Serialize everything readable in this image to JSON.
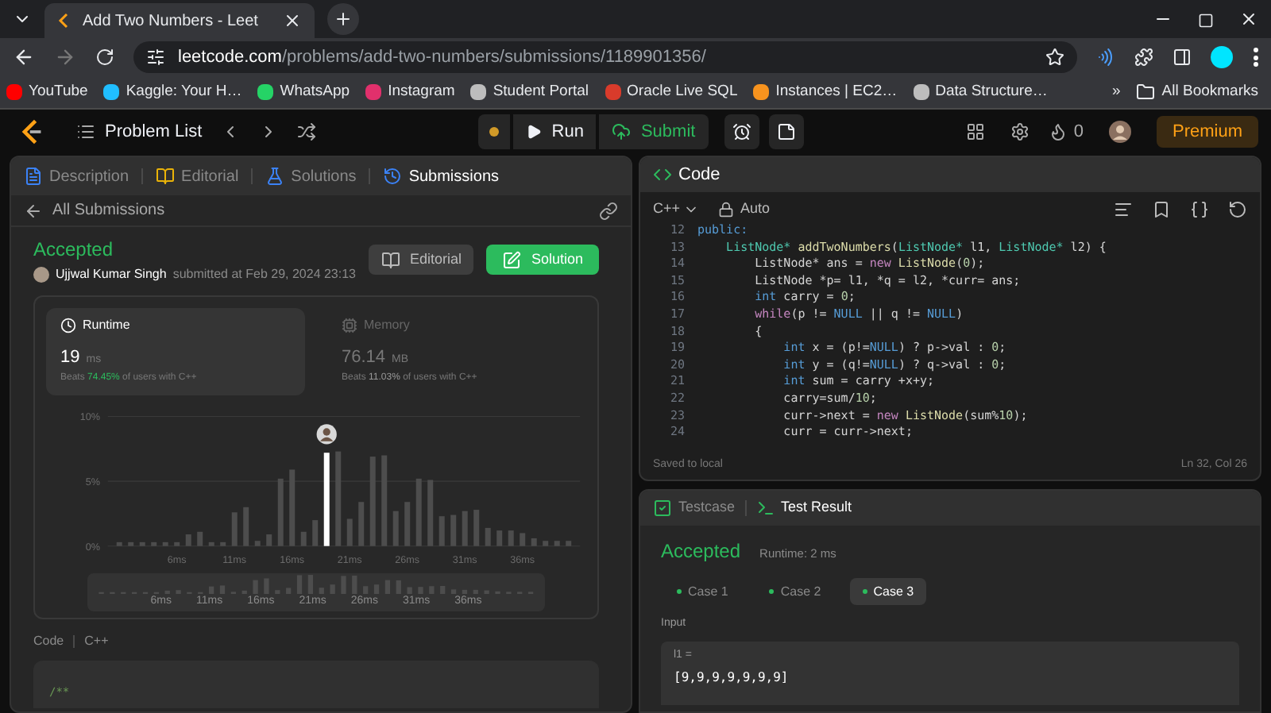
{
  "browser": {
    "tab_title": "Add Two Numbers - Leet",
    "url_domain": "leetcode.com",
    "url_path": "/problems/add-two-numbers/submissions/1189901356/",
    "bookmarks": [
      {
        "label": "YouTube",
        "color": "#ff0000"
      },
      {
        "label": "Kaggle: Your H…",
        "color": "#20beff"
      },
      {
        "label": "WhatsApp",
        "color": "#25d366"
      },
      {
        "label": "Instagram",
        "color": "#e1306c"
      },
      {
        "label": "Student Portal",
        "color": "#bdbdbd"
      },
      {
        "label": "Oracle Live SQL",
        "color": "#d93b2b"
      },
      {
        "label": "Instances | EC2…",
        "color": "#f7931e"
      },
      {
        "label": "Data Structure…",
        "color": "#bdbdbd"
      }
    ],
    "more": "»",
    "all_bookmarks": "All Bookmarks"
  },
  "nav": {
    "problem_list": "Problem List",
    "run": "Run",
    "submit": "Submit",
    "streak": "0",
    "premium": "Premium"
  },
  "left_tabs": [
    {
      "label": "Description",
      "selected": false,
      "color": "#3b82f6"
    },
    {
      "label": "Editorial",
      "selected": false,
      "color": "#eab308"
    },
    {
      "label": "Solutions",
      "selected": false,
      "color": "#3b82f6"
    },
    {
      "label": "Submissions",
      "selected": true,
      "color": "#3b82f6"
    }
  ],
  "back_link": "All Submissions",
  "submission": {
    "status": "Accepted",
    "author": "Ujjwal Kumar Singh",
    "submitted": "submitted at Feb 29, 2024 23:13",
    "editorial_button": "Editorial",
    "solution_button": "Solution"
  },
  "stats": [
    {
      "title": "Runtime",
      "value": "19",
      "unit": "ms",
      "beats_label": "Beats",
      "beats": "74.45%",
      "beats_suffix": "of users with C++",
      "selected": true
    },
    {
      "title": "Memory",
      "value": "76.14",
      "unit": "MB",
      "beats_label": "Beats",
      "beats": "11.03%",
      "beats_suffix": "of users with C++",
      "selected": false
    }
  ],
  "chart_data": {
    "type": "bar",
    "x": [
      1,
      2,
      3,
      4,
      5,
      6,
      7,
      8,
      9,
      10,
      11,
      12,
      13,
      14,
      15,
      16,
      17,
      18,
      19,
      20,
      21,
      22,
      23,
      24,
      25,
      26,
      27,
      28,
      29,
      30,
      31,
      32,
      33,
      34,
      35,
      36,
      37,
      38,
      39,
      40
    ],
    "xlim": [
      0,
      41
    ],
    "series": [
      {
        "color": "#4d4d4d",
        "values": [
          0.3,
          0.3,
          0.3,
          0.3,
          0.3,
          0.3,
          0.9,
          1.1,
          0.3,
          0.3,
          2.6,
          3.0,
          0.4,
          0.9,
          5.2,
          5.9,
          1.1,
          2.0,
          null,
          7.3,
          2.1,
          3.4,
          6.9,
          7.0,
          2.7,
          3.4,
          5.2,
          5.1,
          2.3,
          2.4,
          2.7,
          2.8,
          1.4,
          1.2,
          1.2,
          1.0,
          0.6,
          0.4,
          0.4,
          0.4
        ]
      },
      {
        "color": "#ffffff",
        "values": [
          null,
          null,
          null,
          null,
          null,
          null,
          null,
          null,
          null,
          null,
          null,
          null,
          null,
          null,
          null,
          null,
          null,
          null,
          7.2,
          null,
          null,
          null,
          null,
          null,
          null,
          null,
          null,
          null,
          null,
          null,
          null,
          null,
          null,
          null,
          null,
          null,
          null,
          null,
          null,
          null
        ]
      }
    ],
    "ylim": [
      0,
      10
    ],
    "yticks": [
      {
        "value": 0,
        "label": "0%"
      },
      {
        "value": 5,
        "label": "5%"
      },
      {
        "value": 10,
        "label": "10%"
      }
    ],
    "xticks": [
      {
        "value": 6,
        "label": "6ms"
      },
      {
        "value": 11,
        "label": "11ms"
      },
      {
        "value": 16,
        "label": "16ms"
      },
      {
        "value": 21,
        "label": "21ms"
      },
      {
        "value": 26,
        "label": "26ms"
      },
      {
        "value": 31,
        "label": "31ms"
      },
      {
        "value": 36,
        "label": "36ms"
      }
    ]
  },
  "overview_labels": [
    "6ms",
    "11ms",
    "16ms",
    "21ms",
    "26ms",
    "31ms",
    "36ms"
  ],
  "code_preview": {
    "title": "Code",
    "language": "C++",
    "first_line": "/**"
  },
  "editor": {
    "title": "Code",
    "language": "C++",
    "mode": "Auto",
    "status": "Saved to local",
    "position": "Ln 32, Col 26",
    "lines": [
      {
        "number": "12",
        "tokens": [
          {
            "text": "public:",
            "kind": "keyword"
          }
        ]
      },
      {
        "number": "13",
        "tokens": [
          {
            "text": "    ListNode*",
            "kind": "type"
          },
          {
            "text": " addTwoNumbers",
            "kind": "function"
          },
          {
            "text": "(",
            "kind": "plain"
          },
          {
            "text": "ListNode*",
            "kind": "type"
          },
          {
            "text": " l1, ",
            "kind": "plain"
          },
          {
            "text": "ListNode*",
            "kind": "type"
          },
          {
            "text": " l2) {",
            "kind": "plain"
          }
        ]
      },
      {
        "number": "14",
        "tokens": [
          {
            "text": "        ListNode* ans = ",
            "kind": "plain"
          },
          {
            "text": "new",
            "kind": "control"
          },
          {
            "text": " ListNode",
            "kind": "function"
          },
          {
            "text": "(",
            "kind": "plain"
          },
          {
            "text": "0",
            "kind": "number"
          },
          {
            "text": ");",
            "kind": "plain"
          }
        ]
      },
      {
        "number": "15",
        "tokens": [
          {
            "text": "        ListNode *p= l1, *q = l2, *curr= ans;",
            "kind": "plain"
          }
        ]
      },
      {
        "number": "16",
        "tokens": [
          {
            "text": "        int",
            "kind": "keyword"
          },
          {
            "text": " carry = ",
            "kind": "plain"
          },
          {
            "text": "0",
            "kind": "number"
          },
          {
            "text": ";",
            "kind": "plain"
          }
        ]
      },
      {
        "number": "17",
        "tokens": [
          {
            "text": "        while",
            "kind": "control"
          },
          {
            "text": "(p != ",
            "kind": "plain"
          },
          {
            "text": "NULL",
            "kind": "keyword"
          },
          {
            "text": " || q != ",
            "kind": "plain"
          },
          {
            "text": "NULL",
            "kind": "keyword"
          },
          {
            "text": ")",
            "kind": "plain"
          }
        ]
      },
      {
        "number": "18",
        "tokens": [
          {
            "text": "        {",
            "kind": "plain"
          }
        ]
      },
      {
        "number": "19",
        "tokens": [
          {
            "text": "            int",
            "kind": "keyword"
          },
          {
            "text": " x = (p!=",
            "kind": "plain"
          },
          {
            "text": "NULL",
            "kind": "keyword"
          },
          {
            "text": ") ? p->val : ",
            "kind": "plain"
          },
          {
            "text": "0",
            "kind": "number"
          },
          {
            "text": ";",
            "kind": "plain"
          }
        ]
      },
      {
        "number": "20",
        "tokens": [
          {
            "text": "            int",
            "kind": "keyword"
          },
          {
            "text": " y = (q!=",
            "kind": "plain"
          },
          {
            "text": "NULL",
            "kind": "keyword"
          },
          {
            "text": ") ? q->val : ",
            "kind": "plain"
          },
          {
            "text": "0",
            "kind": "number"
          },
          {
            "text": ";",
            "kind": "plain"
          }
        ]
      },
      {
        "number": "21",
        "tokens": [
          {
            "text": "            int",
            "kind": "keyword"
          },
          {
            "text": " sum = carry +x+y;",
            "kind": "plain"
          }
        ]
      },
      {
        "number": "22",
        "tokens": [
          {
            "text": "            carry=sum/",
            "kind": "plain"
          },
          {
            "text": "10",
            "kind": "number"
          },
          {
            "text": ";",
            "kind": "plain"
          }
        ]
      },
      {
        "number": "23",
        "tokens": [
          {
            "text": "            curr->next = ",
            "kind": "plain"
          },
          {
            "text": "new",
            "kind": "control"
          },
          {
            "text": " ListNode",
            "kind": "function"
          },
          {
            "text": "(sum%",
            "kind": "plain"
          },
          {
            "text": "10",
            "kind": "number"
          },
          {
            "text": ");",
            "kind": "plain"
          }
        ]
      },
      {
        "number": "24",
        "tokens": [
          {
            "text": "            curr = curr->next;",
            "kind": "plain"
          }
        ]
      }
    ]
  },
  "result_tabs": [
    {
      "label": "Testcase",
      "selected": false
    },
    {
      "label": "Test Result",
      "selected": true
    }
  ],
  "result": {
    "status": "Accepted",
    "runtime": "Runtime: 2 ms",
    "cases": [
      {
        "label": "Case 1",
        "selected": false
      },
      {
        "label": "Case 2",
        "selected": false
      },
      {
        "label": "Case 3",
        "selected": true
      }
    ],
    "input_label": "Input",
    "variable": "l1 =",
    "value": "[9,9,9,9,9,9,9]"
  }
}
